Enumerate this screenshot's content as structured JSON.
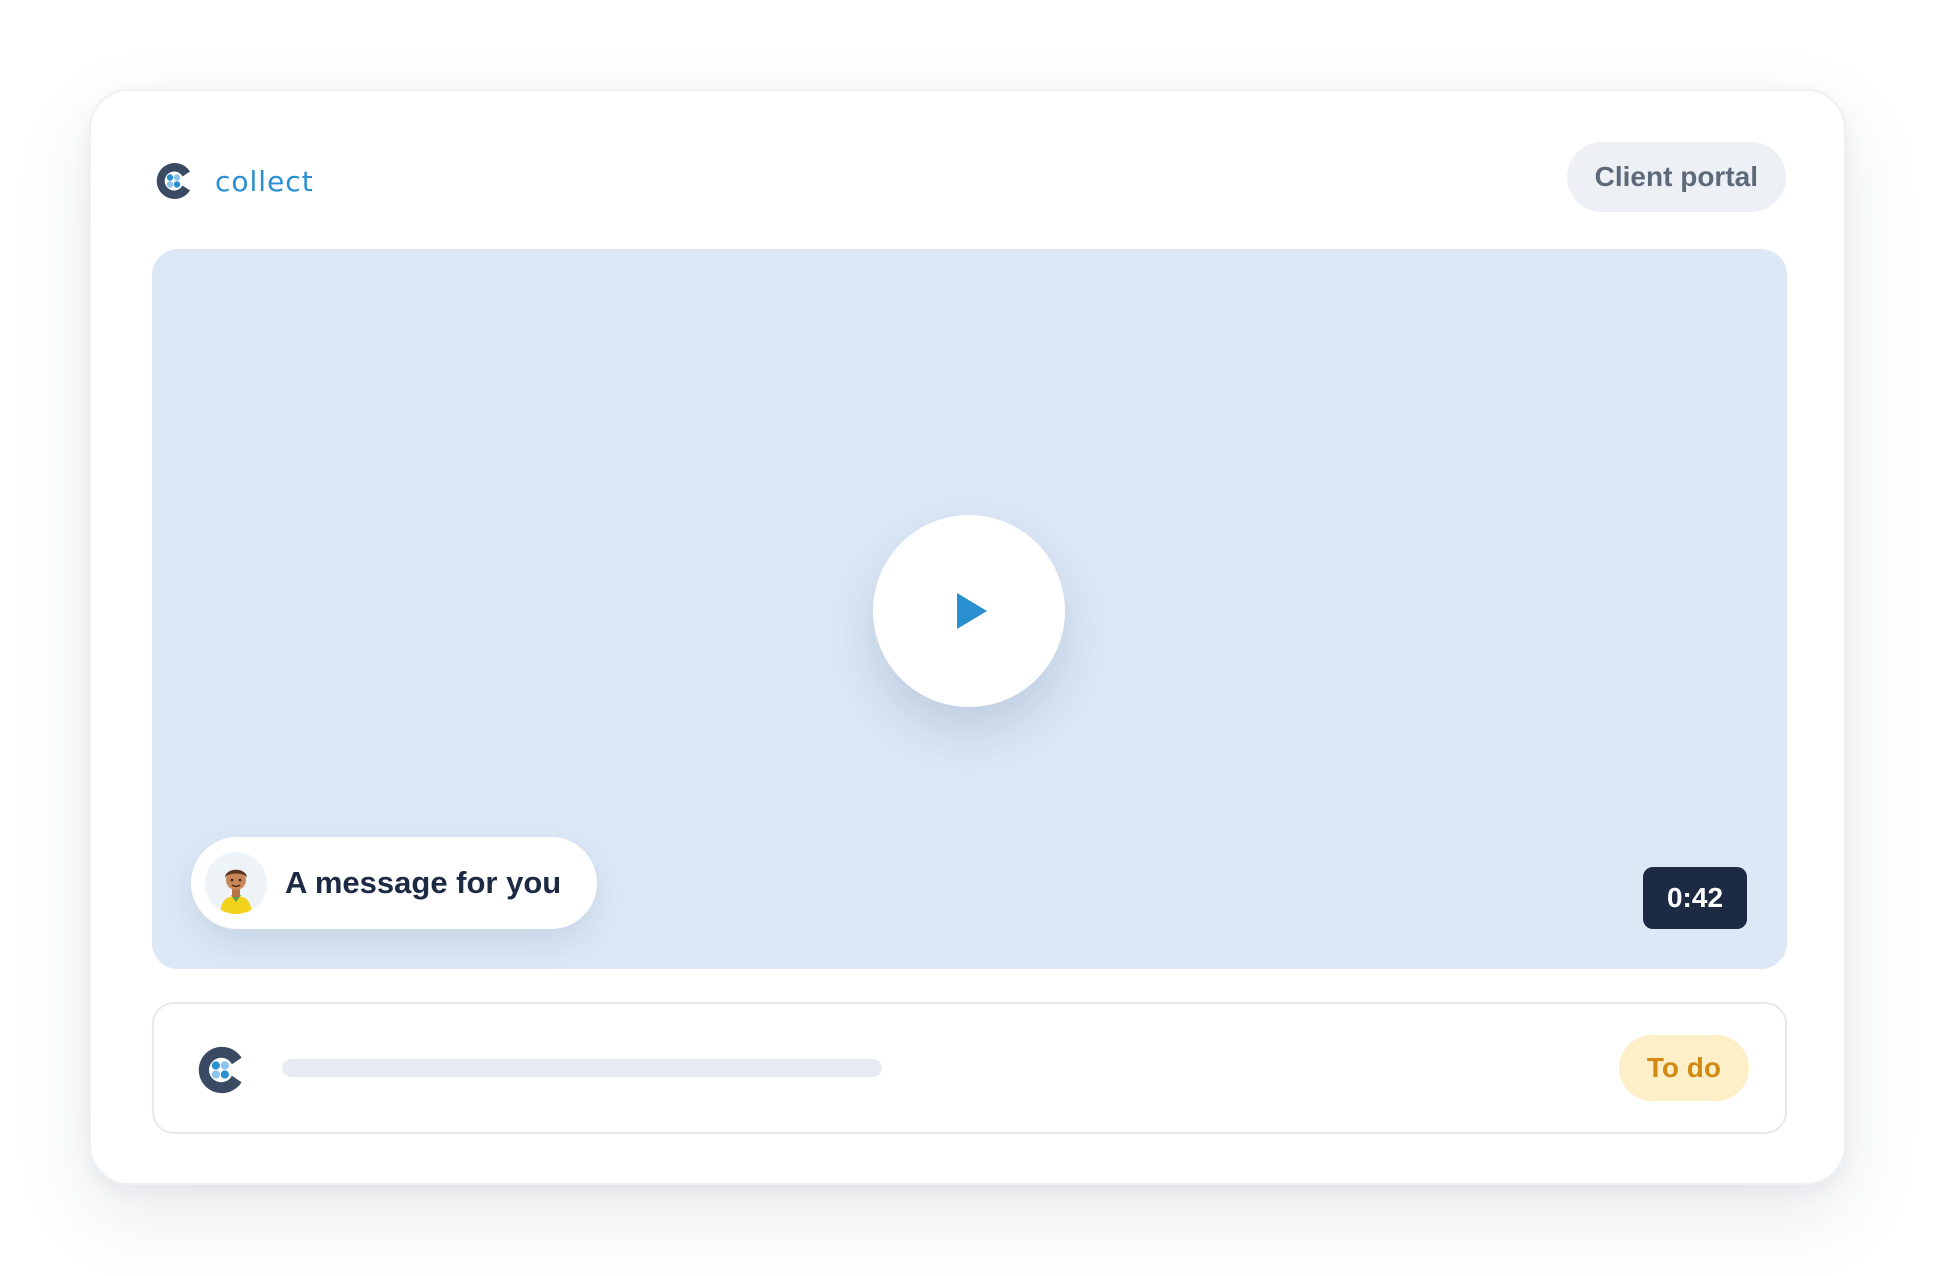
{
  "header": {
    "brand_name": "collect",
    "logo_icon": "collect-logo-icon",
    "portal_label": "Client portal"
  },
  "video": {
    "play_icon": "play-icon",
    "message_label": "A message for you",
    "avatar_icon": "person-avatar-icon",
    "duration": "0:42"
  },
  "task": {
    "logo_icon": "collect-logo-icon",
    "status_label": "To do"
  },
  "colors": {
    "brand": "#2a8fd0",
    "logo_dark": "#3a4a62",
    "video_bg": "#dce8f6",
    "badge_dark": "#1c2a44",
    "todo_bg": "#fdefc7",
    "todo_text": "#d28a12"
  }
}
